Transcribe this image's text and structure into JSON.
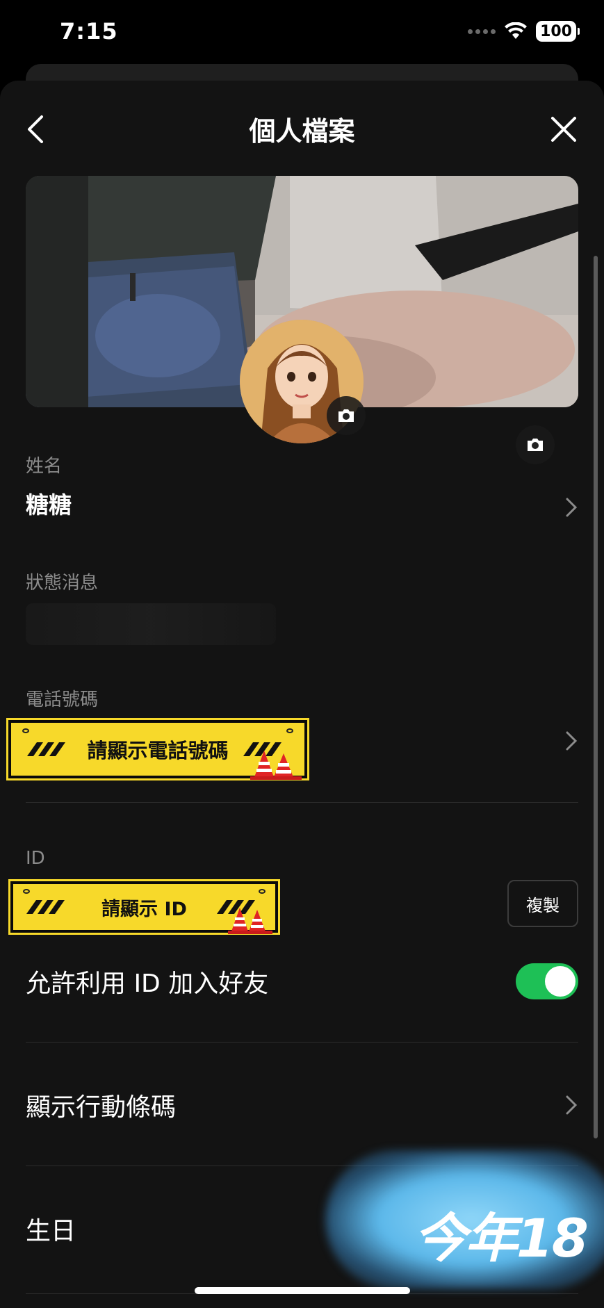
{
  "status_bar": {
    "time": "7:15",
    "battery": "100"
  },
  "header": {
    "title": "個人檔案"
  },
  "profile": {
    "name_label": "姓名",
    "name_value": "糖糖",
    "status_label": "狀態消息",
    "phone_label": "電話號碼",
    "phone_sticker": "請顯示電話號碼",
    "id_label": "ID",
    "id_sticker": "請顯示 ID",
    "copy_label": "複製",
    "allow_id_label": "允許利用 ID 加入好友",
    "allow_id_enabled": true,
    "barcode_label": "顯示行動條碼",
    "birthday_label": "生日",
    "birthday_overlay": "今年18"
  },
  "colors": {
    "toggle_on": "#1ec056",
    "sticker": "#f7d92a",
    "glow": "#5cb8ea"
  }
}
